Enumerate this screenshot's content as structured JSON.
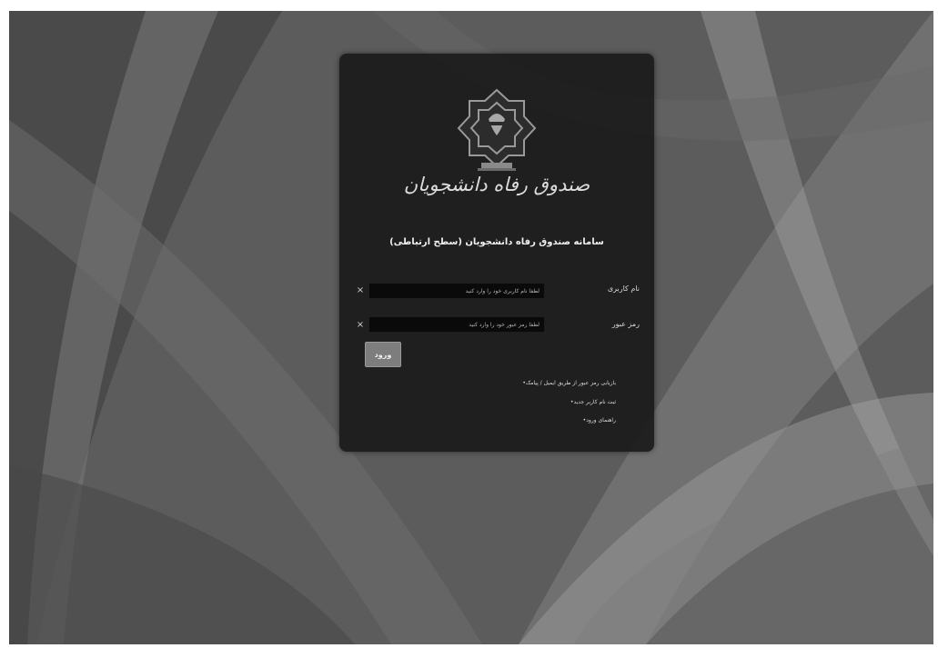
{
  "brand": {
    "name": "صندوق رفاه دانشجویان"
  },
  "system_title": "سامانه صندوق رفاه دانشجویان (سطح ارتباطی)",
  "form": {
    "username_label": "نام کاربری",
    "username_placeholder": "لطفا نام کاربری خود را وارد کنید",
    "password_label": "رمز عبور",
    "password_placeholder": "لطفا رمز عبور خود را وارد کنید",
    "clear_icon": "×",
    "submit_label": "ورود"
  },
  "links": [
    "بازیابی رمز عبور از طریق ایمیل / پیامک",
    "ثبت نام کاربر جدید",
    "راهنمای ورود"
  ],
  "icons": {
    "logo": "university-emblem-icon",
    "clear": "close-icon",
    "bullet": "dot-icon"
  },
  "colors": {
    "card": "#1c1c1c",
    "input": "#0a0a0a",
    "button": "#7d7d7d",
    "background": "#5a5a5a"
  }
}
